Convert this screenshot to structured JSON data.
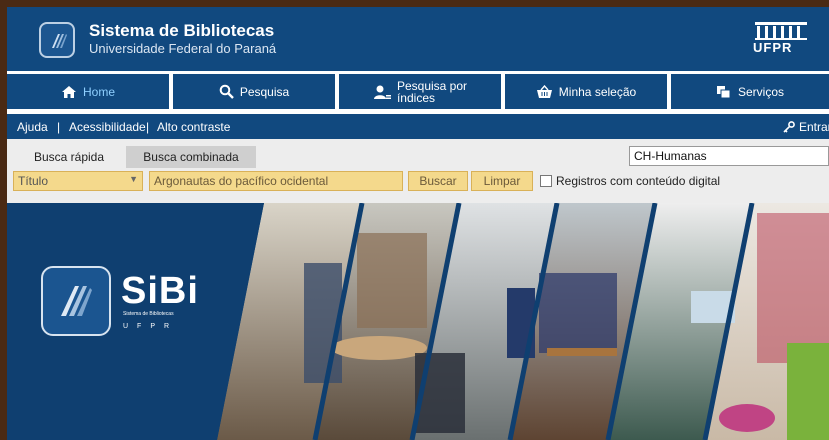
{
  "header": {
    "title": "Sistema de Bibliotecas",
    "subtitle": "Universidade Federal do Paraná",
    "brand_logo_text": "UFPR"
  },
  "nav": [
    {
      "label": "Home",
      "icon": "home-icon",
      "active": true
    },
    {
      "label": "Pesquisa",
      "icon": "search-icon",
      "active": false
    },
    {
      "label_line1": "Pesquisa por",
      "label_line2": "índices",
      "icon": "user-index-icon",
      "active": false
    },
    {
      "label": "Minha seleção",
      "icon": "basket-icon",
      "active": false
    },
    {
      "label": "Serviços",
      "icon": "services-icon",
      "active": false
    }
  ],
  "utility": {
    "help": "Ajuda",
    "accessibility": "Acessibilidade",
    "contrast": "Alto contraste",
    "login": "Entrar",
    "separator": "|"
  },
  "search": {
    "tab_quick": "Busca rápida",
    "tab_combined": "Busca combinada",
    "library_select": "CH-Humanas",
    "field_select": "Título",
    "query_value": "Argonautas do pacífico ocidental",
    "search_button": "Buscar",
    "clear_button": "Limpar",
    "digital_only_label": "Registros com conteúdo digital",
    "digital_only_checked": false
  },
  "banner": {
    "logo_name": "SiBi",
    "logo_subtitle": "Sistema de Bibliotecas",
    "logo_org": "UFPR"
  },
  "colors": {
    "primary": "#11497f",
    "active_nav_text": "#8fd0ff",
    "search_field": "#f4d98c"
  }
}
